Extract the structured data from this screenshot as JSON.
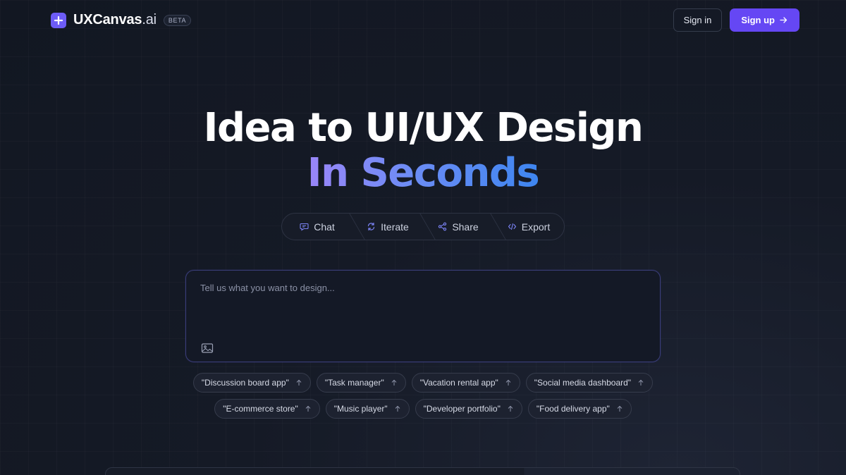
{
  "header": {
    "brand_name": "UXCanvas",
    "brand_suffix": ".ai",
    "beta_label": "BETA",
    "signin_label": "Sign in",
    "signup_label": "Sign up"
  },
  "hero": {
    "title_line1": "Idea to UI/UX Design",
    "title_line2": "In Seconds"
  },
  "features": [
    {
      "label": "Chat",
      "icon": "chat-icon"
    },
    {
      "label": "Iterate",
      "icon": "refresh-icon"
    },
    {
      "label": "Share",
      "icon": "share-icon"
    },
    {
      "label": "Export",
      "icon": "code-icon"
    }
  ],
  "prompt": {
    "placeholder": "Tell us what you want to design...",
    "value": ""
  },
  "suggestions": {
    "row1": [
      "\"Discussion board app\"",
      "\"Task manager\"",
      "\"Vacation rental app\"",
      "\"Social media dashboard\""
    ],
    "row2": [
      "\"E-commerce store\"",
      "\"Music player\"",
      "\"Developer portfolio\"",
      "\"Food delivery app\""
    ]
  },
  "colors": {
    "accent": "#6547f4",
    "logo": "#6d5cf6",
    "gradient_start": "#9a86f8",
    "gradient_end": "#3e86f0",
    "background": "#151a26"
  }
}
